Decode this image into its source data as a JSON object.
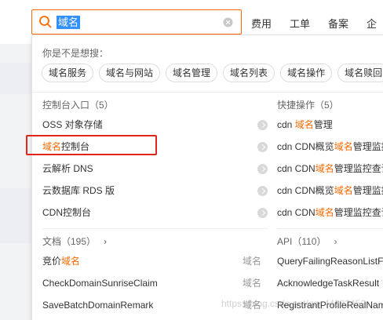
{
  "search": {
    "value": "域名",
    "placeholder": ""
  },
  "top_nav": [
    "费用",
    "工单",
    "备案",
    "企"
  ],
  "suggest": {
    "title": "你是不是想搜：",
    "chips": [
      "域名服务",
      "域名与网站",
      "域名管理",
      "域名列表",
      "域名操作",
      "域名赎回"
    ]
  },
  "console": {
    "title": "控制台入口（5）",
    "items": [
      {
        "pre": "OSS 对象存储",
        "hl": "",
        "post": ""
      },
      {
        "pre": "",
        "hl": "域名",
        "post": "控制台"
      },
      {
        "pre": "云解析 DNS",
        "hl": "",
        "post": ""
      },
      {
        "pre": "云数据库 RDS 版",
        "hl": "",
        "post": ""
      },
      {
        "pre": "CDN控制台",
        "hl": "",
        "post": ""
      }
    ]
  },
  "quick": {
    "title": "快捷操作（5）",
    "items": [
      {
        "pre": "cdn ",
        "hl": "域名",
        "post": "管理"
      },
      {
        "pre": "cdn CDN概览",
        "hl": "域名",
        "post": "管理监控查询"
      },
      {
        "pre": "cdn CDN",
        "hl": "域名",
        "post": "管理监控查询"
      },
      {
        "pre": "cdn CDN概览",
        "hl": "域名",
        "post": "管理监控查询"
      },
      {
        "pre": "cdn CDN",
        "hl": "域名",
        "post": "管理监控查询"
      }
    ]
  },
  "docs": {
    "title": "文档（195）",
    "items": [
      {
        "pre": "竞价",
        "hl": "域名",
        "post": "",
        "tag": "域名"
      },
      {
        "pre": "CheckDomainSunriseClaim",
        "hl": "",
        "post": "",
        "tag": "域名"
      },
      {
        "pre": "SaveBatchDomainRemark",
        "hl": "",
        "post": "",
        "tag": "域名"
      }
    ]
  },
  "api": {
    "title": "API（110）",
    "items": [
      {
        "pre": "QueryFailingReasonListForFailing",
        "hl": "",
        "post": ""
      },
      {
        "pre": "AcknowledgeTaskResult",
        "hl": "",
        "post": ""
      },
      {
        "pre": "RegistrantProfileRealNameVerification",
        "hl": "",
        "post": ""
      }
    ]
  },
  "watermark": "https://blog.csdn.net/qq_44382452",
  "colors": {
    "accent": "#ff6a00",
    "highlight_box": "#e1251b",
    "selection": "#3390ff"
  }
}
